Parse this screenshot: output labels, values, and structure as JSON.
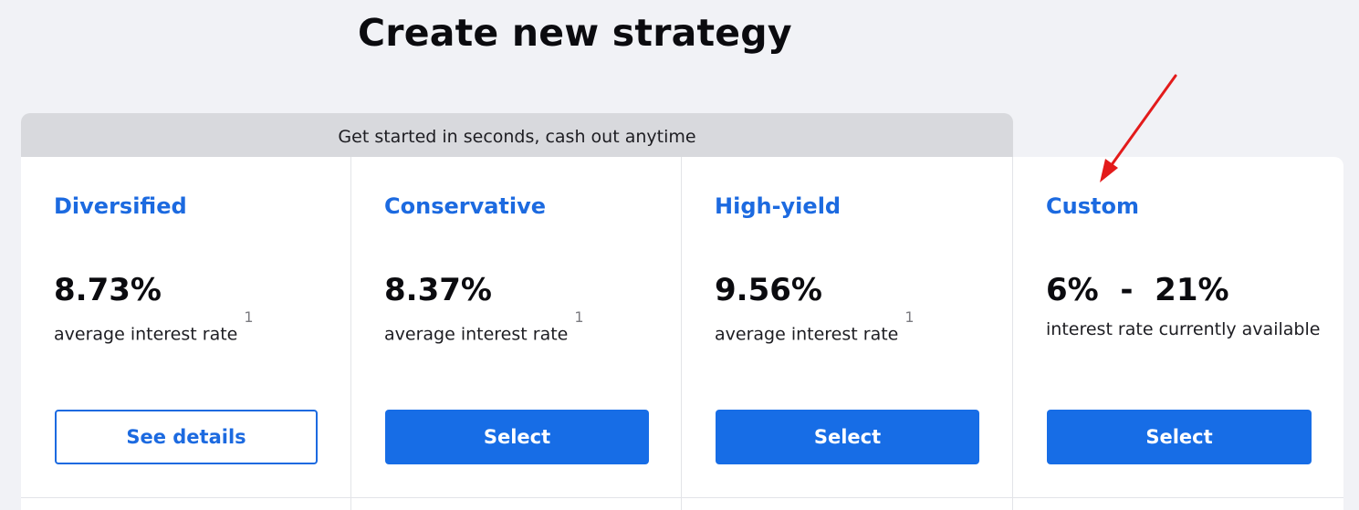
{
  "page": {
    "title": "Create new strategy",
    "banner": "Get started in seconds, cash out anytime"
  },
  "strategies": [
    {
      "name": "Diversified",
      "rate": "8.73%",
      "description": "average interest rate",
      "footnote": "1",
      "button": "See details"
    },
    {
      "name": "Conservative",
      "rate": "8.37%",
      "description": "average interest rate",
      "footnote": "1",
      "button": "Select"
    },
    {
      "name": "High-yield",
      "rate": "9.56%",
      "description": "average interest rate",
      "footnote": "1",
      "button": "Select"
    },
    {
      "name": "Custom",
      "rate": "6%  -  21%",
      "description": "interest rate currently available",
      "button": "Select"
    }
  ],
  "colors": {
    "accent": "#1c6ae0",
    "button": "#176de6",
    "background": "#f1f2f6",
    "banner": "#d8d9dd",
    "annotation_arrow": "#e31b1b"
  }
}
